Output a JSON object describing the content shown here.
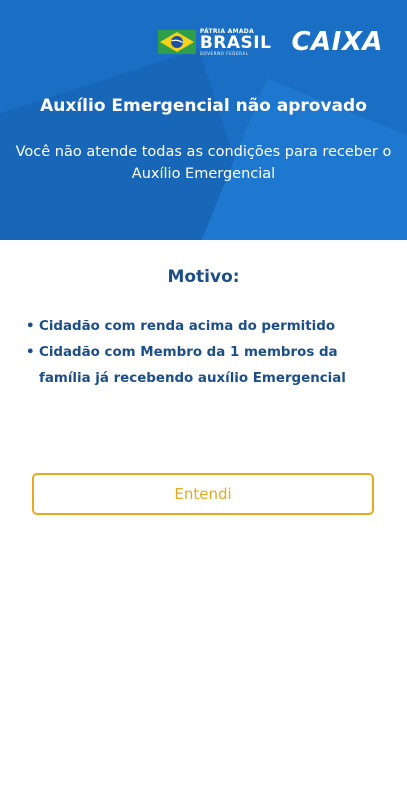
{
  "header": {
    "gov_logo": {
      "top_line": "PÁTRIA AMADA",
      "main": "BRASIL",
      "bottom_line": "GOVERNO FEDERAL"
    },
    "caixa_logo": "CAIXA",
    "title": "Auxílio Emergencial não aprovado",
    "subtitle": "Você não atende todas as condições para receber o Auxílio Emergencial"
  },
  "main": {
    "reason_heading": "Motivo:",
    "reasons": [
      "Cidadão com renda acima do permitido",
      "Cidadão com Membro da 1 membros da família já recebendo auxílio Emergencial"
    ],
    "bullet": "•",
    "button_label": "Entendi"
  },
  "colors": {
    "header_blue": "#1a6fc4",
    "text_navy": "#1c4f8a",
    "accent_orange": "#e8a91e"
  }
}
